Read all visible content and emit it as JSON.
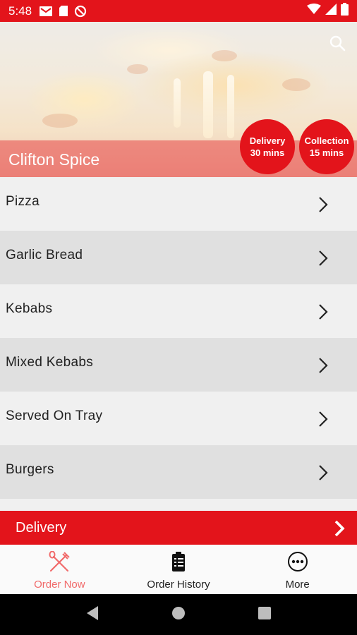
{
  "status_bar": {
    "time": "5:48",
    "left_icons": [
      "gmail-icon",
      "sd-card-icon",
      "do-not-disturb-icon"
    ],
    "right_icons": [
      "wifi-icon",
      "signal-icon",
      "battery-icon"
    ],
    "color": "#e3141b"
  },
  "header": {
    "restaurant_name": "Clifton Spice",
    "search_icon": "search-icon",
    "delivery_badge": {
      "line1": "Delivery",
      "line2": "30 mins"
    },
    "collection_badge": {
      "line1": "Collection",
      "line2": "15 mins"
    }
  },
  "categories": [
    {
      "label": "Pizza"
    },
    {
      "label": "Garlic Bread"
    },
    {
      "label": "Kebabs"
    },
    {
      "label": "Mixed Kebabs"
    },
    {
      "label": "Served On Tray"
    },
    {
      "label": "Burgers"
    }
  ],
  "order_mode": {
    "label": "Delivery"
  },
  "bottom_nav": {
    "items": [
      {
        "label": "Order Now",
        "icon": "fork-knife-icon",
        "active": true
      },
      {
        "label": "Order History",
        "icon": "clipboard-icon",
        "active": false
      },
      {
        "label": "More",
        "icon": "more-icon",
        "active": false
      }
    ]
  },
  "colors": {
    "accent": "#e3141b",
    "active_nav": "#f16a6a"
  }
}
